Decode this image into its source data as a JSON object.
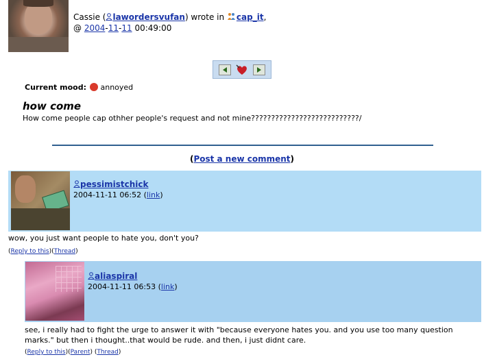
{
  "entry": {
    "poster_name": "Cassie (",
    "poster_username": "lawordersvufan",
    "wrote_in": ") wrote in ",
    "community": "cap_it",
    "comma": ",",
    "at": "@",
    "date_year": "2004",
    "date_month": "11",
    "date_day": "11",
    "time": "00:49:00",
    "mood_label": "Current mood:",
    "mood_value": "annoyed",
    "subject": "how come",
    "body": "How come people cap othher people's request and not mine???????????????????????????/"
  },
  "post_comment_link": "Post a new comment",
  "post_comment_open": "(",
  "post_comment_close": ")",
  "comments": [
    {
      "username": "pessimistchick",
      "datetime": "2004-11-11 06:52",
      "link_label": "link",
      "body": "wow, you just want people to hate you, don't you?",
      "reply_label": "Reply to this",
      "thread_label": "Thread"
    },
    {
      "username": "aliaspiral",
      "datetime": "2004-11-11 06:53",
      "link_label": "link",
      "body": "see, i really had to fight the urge to answer it with \"because everyone hates you. and you use too many question marks.\" but then i thought..that would be rude. and then, i just didnt care.",
      "reply_label": "Reply to this",
      "parent_label": "Parent",
      "thread_label": "Thread"
    }
  ],
  "colors": {
    "link": "#1a35a8",
    "comment_header_1": "#b3dcf6",
    "comment_header_2": "#a7d1f0",
    "divider": "#2f5f8f"
  },
  "icons": [
    "user-icon",
    "community-icon",
    "prev-arrow-icon",
    "memories-heart-icon",
    "next-arrow-icon",
    "angry-mood-icon"
  ]
}
